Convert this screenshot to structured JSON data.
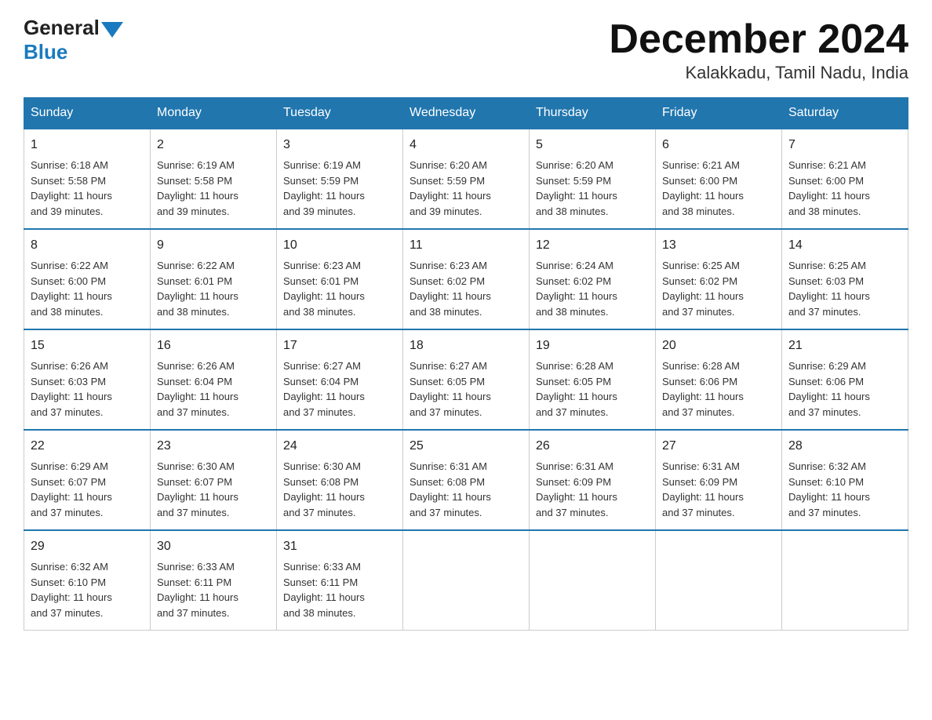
{
  "header": {
    "logo_general": "General",
    "logo_blue": "Blue",
    "title": "December 2024",
    "subtitle": "Kalakkadu, Tamil Nadu, India"
  },
  "days_of_week": [
    "Sunday",
    "Monday",
    "Tuesday",
    "Wednesday",
    "Thursday",
    "Friday",
    "Saturday"
  ],
  "weeks": [
    [
      {
        "day": "1",
        "sunrise": "6:18 AM",
        "sunset": "5:58 PM",
        "daylight": "11 hours and 39 minutes."
      },
      {
        "day": "2",
        "sunrise": "6:19 AM",
        "sunset": "5:58 PM",
        "daylight": "11 hours and 39 minutes."
      },
      {
        "day": "3",
        "sunrise": "6:19 AM",
        "sunset": "5:59 PM",
        "daylight": "11 hours and 39 minutes."
      },
      {
        "day": "4",
        "sunrise": "6:20 AM",
        "sunset": "5:59 PM",
        "daylight": "11 hours and 39 minutes."
      },
      {
        "day": "5",
        "sunrise": "6:20 AM",
        "sunset": "5:59 PM",
        "daylight": "11 hours and 38 minutes."
      },
      {
        "day": "6",
        "sunrise": "6:21 AM",
        "sunset": "6:00 PM",
        "daylight": "11 hours and 38 minutes."
      },
      {
        "day": "7",
        "sunrise": "6:21 AM",
        "sunset": "6:00 PM",
        "daylight": "11 hours and 38 minutes."
      }
    ],
    [
      {
        "day": "8",
        "sunrise": "6:22 AM",
        "sunset": "6:00 PM",
        "daylight": "11 hours and 38 minutes."
      },
      {
        "day": "9",
        "sunrise": "6:22 AM",
        "sunset": "6:01 PM",
        "daylight": "11 hours and 38 minutes."
      },
      {
        "day": "10",
        "sunrise": "6:23 AM",
        "sunset": "6:01 PM",
        "daylight": "11 hours and 38 minutes."
      },
      {
        "day": "11",
        "sunrise": "6:23 AM",
        "sunset": "6:02 PM",
        "daylight": "11 hours and 38 minutes."
      },
      {
        "day": "12",
        "sunrise": "6:24 AM",
        "sunset": "6:02 PM",
        "daylight": "11 hours and 38 minutes."
      },
      {
        "day": "13",
        "sunrise": "6:25 AM",
        "sunset": "6:02 PM",
        "daylight": "11 hours and 37 minutes."
      },
      {
        "day": "14",
        "sunrise": "6:25 AM",
        "sunset": "6:03 PM",
        "daylight": "11 hours and 37 minutes."
      }
    ],
    [
      {
        "day": "15",
        "sunrise": "6:26 AM",
        "sunset": "6:03 PM",
        "daylight": "11 hours and 37 minutes."
      },
      {
        "day": "16",
        "sunrise": "6:26 AM",
        "sunset": "6:04 PM",
        "daylight": "11 hours and 37 minutes."
      },
      {
        "day": "17",
        "sunrise": "6:27 AM",
        "sunset": "6:04 PM",
        "daylight": "11 hours and 37 minutes."
      },
      {
        "day": "18",
        "sunrise": "6:27 AM",
        "sunset": "6:05 PM",
        "daylight": "11 hours and 37 minutes."
      },
      {
        "day": "19",
        "sunrise": "6:28 AM",
        "sunset": "6:05 PM",
        "daylight": "11 hours and 37 minutes."
      },
      {
        "day": "20",
        "sunrise": "6:28 AM",
        "sunset": "6:06 PM",
        "daylight": "11 hours and 37 minutes."
      },
      {
        "day": "21",
        "sunrise": "6:29 AM",
        "sunset": "6:06 PM",
        "daylight": "11 hours and 37 minutes."
      }
    ],
    [
      {
        "day": "22",
        "sunrise": "6:29 AM",
        "sunset": "6:07 PM",
        "daylight": "11 hours and 37 minutes."
      },
      {
        "day": "23",
        "sunrise": "6:30 AM",
        "sunset": "6:07 PM",
        "daylight": "11 hours and 37 minutes."
      },
      {
        "day": "24",
        "sunrise": "6:30 AM",
        "sunset": "6:08 PM",
        "daylight": "11 hours and 37 minutes."
      },
      {
        "day": "25",
        "sunrise": "6:31 AM",
        "sunset": "6:08 PM",
        "daylight": "11 hours and 37 minutes."
      },
      {
        "day": "26",
        "sunrise": "6:31 AM",
        "sunset": "6:09 PM",
        "daylight": "11 hours and 37 minutes."
      },
      {
        "day": "27",
        "sunrise": "6:31 AM",
        "sunset": "6:09 PM",
        "daylight": "11 hours and 37 minutes."
      },
      {
        "day": "28",
        "sunrise": "6:32 AM",
        "sunset": "6:10 PM",
        "daylight": "11 hours and 37 minutes."
      }
    ],
    [
      {
        "day": "29",
        "sunrise": "6:32 AM",
        "sunset": "6:10 PM",
        "daylight": "11 hours and 37 minutes."
      },
      {
        "day": "30",
        "sunrise": "6:33 AM",
        "sunset": "6:11 PM",
        "daylight": "11 hours and 37 minutes."
      },
      {
        "day": "31",
        "sunrise": "6:33 AM",
        "sunset": "6:11 PM",
        "daylight": "11 hours and 38 minutes."
      },
      {
        "day": "",
        "sunrise": "",
        "sunset": "",
        "daylight": ""
      },
      {
        "day": "",
        "sunrise": "",
        "sunset": "",
        "daylight": ""
      },
      {
        "day": "",
        "sunrise": "",
        "sunset": "",
        "daylight": ""
      },
      {
        "day": "",
        "sunrise": "",
        "sunset": "",
        "daylight": ""
      }
    ]
  ],
  "labels": {
    "sunrise": "Sunrise:",
    "sunset": "Sunset:",
    "daylight": "Daylight:"
  }
}
